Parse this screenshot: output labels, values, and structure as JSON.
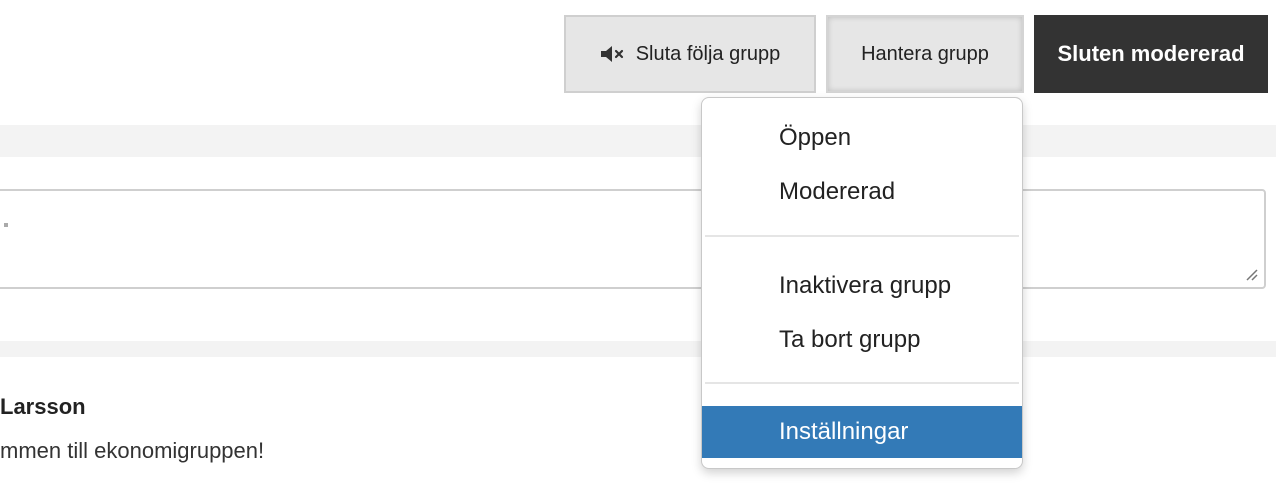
{
  "toolbar": {
    "unfollow_label": "Sluta följa grupp",
    "unfollow_icon": "mute-icon",
    "manage_label": "Hantera grupp",
    "status_label": "Sluten modererad"
  },
  "menu": {
    "items": [
      {
        "label": "Öppen"
      },
      {
        "label": "Modererad"
      },
      {
        "label": "Inaktivera grupp"
      },
      {
        "label": "Ta bort grupp"
      },
      {
        "label": "Inställningar",
        "highlighted": true
      }
    ]
  },
  "post": {
    "author": "Larsson",
    "text": "mmen till ekonomigruppen!"
  },
  "colors": {
    "highlight": "#337ab7",
    "status_button": "#333333",
    "button_bg": "#e6e6e6"
  }
}
